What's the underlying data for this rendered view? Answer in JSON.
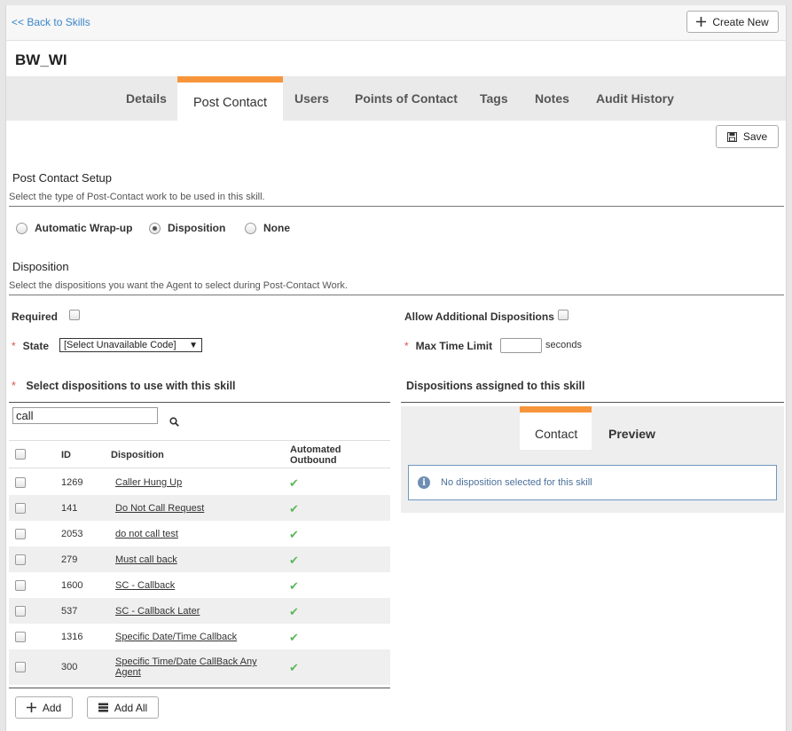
{
  "topbar": {
    "back_label": "<< Back to Skills",
    "create_label": "Create New"
  },
  "page_title": "BW_WI",
  "tabs": [
    {
      "label": "Details"
    },
    {
      "label": "Post Contact"
    },
    {
      "label": "Users"
    },
    {
      "label": "Points of Contact"
    },
    {
      "label": "Tags"
    },
    {
      "label": "Notes"
    },
    {
      "label": "Audit History"
    }
  ],
  "save_label": "Save",
  "setup": {
    "title": "Post Contact Setup",
    "subtitle": "Select the type of Post-Contact work to be used in this skill.",
    "options": [
      {
        "label": "Automatic Wrap-up",
        "checked": false
      },
      {
        "label": "Disposition",
        "checked": true
      },
      {
        "label": "None",
        "checked": false
      }
    ]
  },
  "disposition": {
    "title": "Disposition",
    "subtitle": "Select the dispositions you want the Agent to select during Post-Contact Work.",
    "required_label": "Required",
    "allow_label": "Allow Additional Dispositions",
    "state_label": "State",
    "state_value": "[Select Unavailable Code]",
    "max_time_label": "Max Time Limit",
    "max_time_unit": "seconds",
    "max_time_value": ""
  },
  "select_panel": {
    "title": "Select dispositions to use with this skill",
    "search_value": "call",
    "columns": {
      "id": "ID",
      "disposition": "Disposition",
      "automated": "Automated Outbound"
    },
    "rows": [
      {
        "id": "1269",
        "disposition": "Caller Hung Up",
        "automated": true
      },
      {
        "id": "141",
        "disposition": "Do Not Call Request",
        "automated": true
      },
      {
        "id": "2053",
        "disposition": "do not call test",
        "automated": true
      },
      {
        "id": "279",
        "disposition": "Must call back",
        "automated": true
      },
      {
        "id": "1600",
        "disposition": "SC - Callback",
        "automated": true
      },
      {
        "id": "537",
        "disposition": "SC - Callback Later",
        "automated": true
      },
      {
        "id": "1316",
        "disposition": "Specific Date/Time Callback",
        "automated": true
      },
      {
        "id": "300",
        "disposition": "Specific Time/Date CallBack Any Agent",
        "automated": true
      }
    ],
    "add_label": "Add",
    "add_all_label": "Add All"
  },
  "assigned_panel": {
    "title": "Dispositions assigned to this skill",
    "tabs": [
      {
        "label": "Contact"
      },
      {
        "label": "Preview"
      }
    ],
    "empty_message": "No disposition selected for this skill"
  },
  "colors": {
    "accent": "#f7953b",
    "link": "#3a86c8",
    "check": "#5cb85c",
    "info_border": "#6f97c2"
  }
}
